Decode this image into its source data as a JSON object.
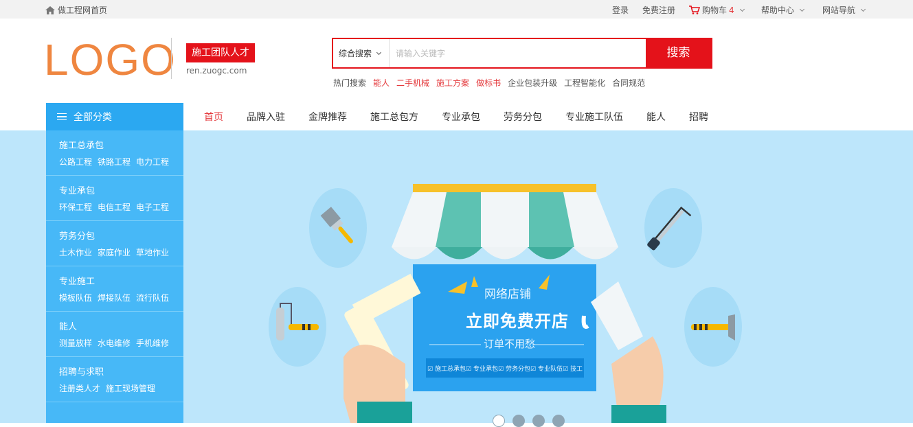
{
  "topbar": {
    "home": "做工程网首页",
    "login": "登录",
    "register": "免费注册",
    "cart_label": "购物车",
    "cart_count": "4",
    "help": "帮助中心",
    "sitenav": "网站导航"
  },
  "header": {
    "logo": "LOGO",
    "badge": "施工团队人才",
    "url": "ren.zuogc.com"
  },
  "search": {
    "scope": "综合搜索",
    "placeholder": "请输入关键字",
    "button": "搜索",
    "hot_label": "热门搜索",
    "hot": [
      {
        "text": "能人",
        "highlight": true
      },
      {
        "text": "二手机械",
        "highlight": true
      },
      {
        "text": "施工方案",
        "highlight": true
      },
      {
        "text": "做标书",
        "highlight": true
      },
      {
        "text": "企业包装升级",
        "highlight": false
      },
      {
        "text": "工程智能化",
        "highlight": false
      },
      {
        "text": "合同规范",
        "highlight": false
      }
    ]
  },
  "categories": {
    "label": "全部分类",
    "groups": [
      {
        "title": "施工总承包",
        "subs": [
          "公路工程",
          "铁路工程",
          "电力工程"
        ]
      },
      {
        "title": "专业承包",
        "subs": [
          "环保工程",
          "电信工程",
          "电子工程"
        ]
      },
      {
        "title": "劳务分包",
        "subs": [
          "土木作业",
          "家庭作业",
          "草地作业"
        ]
      },
      {
        "title": "专业施工",
        "subs": [
          "模板队伍",
          "焊接队伍",
          "流行队伍"
        ]
      },
      {
        "title": "能人",
        "subs": [
          "测量放样",
          "水电维修",
          "手机维修"
        ]
      },
      {
        "title": "招聘与求职",
        "subs": [
          "注册类人才",
          "施工现场管理"
        ]
      }
    ]
  },
  "nav": [
    "首页",
    "品牌入驻",
    "金牌推荐",
    "施工总包方",
    "专业承包",
    "劳务分包",
    "专业施工队伍",
    "能人",
    "招聘"
  ],
  "banner": {
    "shop": "网络店铺",
    "headline": "立即免费开店",
    "sub": "订单不用愁",
    "tags": [
      "施工总承包",
      "专业承包",
      "劳务分包",
      "专业队伍",
      "技工"
    ],
    "slides_total": 4,
    "slide_active": 1
  },
  "colors": {
    "accent_red": "#e4121a",
    "sidebar_blue": "#47b8f7",
    "banner_bg": "#bde6fb",
    "logo_orange": "#ef8640"
  }
}
